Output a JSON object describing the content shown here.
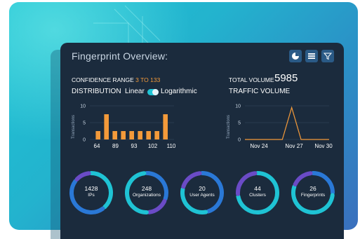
{
  "title": "Fingerprint Overview:",
  "toolbar": {
    "icons": [
      "pie-chart-icon",
      "list-icon",
      "filter-icon"
    ],
    "accent": "#2a5a86"
  },
  "confidence": {
    "label": "CONFIDENCE RANGE",
    "value": "3 TO 133"
  },
  "distribution": {
    "label": "DISTRIBUTION",
    "linear": "Linear",
    "log": "Logarithmic"
  },
  "total_volume": {
    "label": "TOTAL VOLUME",
    "value": "5985"
  },
  "traffic_volume": {
    "label": "TRAFFIC VOLUME"
  },
  "chart_data": [
    {
      "type": "bar",
      "ylabel": "Transactions",
      "ylim": [
        0,
        10
      ],
      "yticks": [
        "10",
        "5",
        "0"
      ],
      "xticklabels": [
        "64",
        "89",
        "93",
        "102",
        "110"
      ],
      "values": [
        2.5,
        7.5,
        2.5,
        2.5,
        2.5,
        2.5,
        2.5,
        2.5,
        7.5
      ],
      "color": "#f39a3a"
    },
    {
      "type": "line",
      "ylabel": "Transactions",
      "ylim": [
        0,
        10
      ],
      "yticks": [
        "10",
        "5",
        "0"
      ],
      "xticklabels": [
        "Nov 24",
        "Nov 27",
        "Nov 30"
      ],
      "values": [
        0,
        0,
        0,
        0,
        0,
        9.5,
        0,
        0,
        0,
        0
      ],
      "color": "#f39a3a"
    }
  ],
  "stats": [
    {
      "count": "1428",
      "label": "IPs"
    },
    {
      "count": "248",
      "label": "Organizations"
    },
    {
      "count": "20",
      "label": "User Agents"
    },
    {
      "count": "44",
      "label": "Clusters"
    },
    {
      "count": "26",
      "label": "Fingerprints"
    }
  ],
  "colors": {
    "teal": "#1fc3d4",
    "blue": "#2a78d6",
    "purple": "#6a4bc6",
    "orange": "#f39a3a",
    "panel": "#1b2b3d"
  }
}
